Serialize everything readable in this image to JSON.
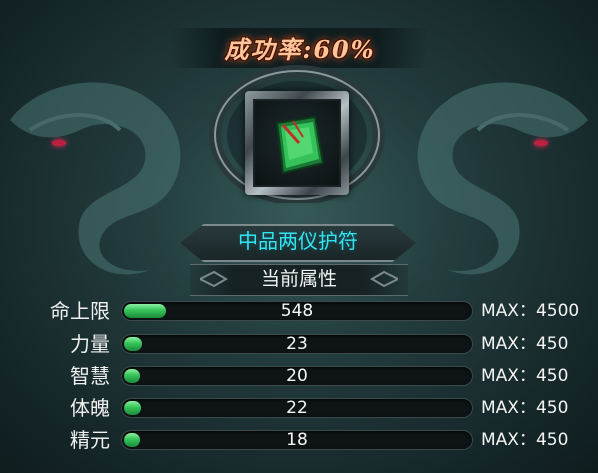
{
  "header": {
    "success_rate": "成功率:60%"
  },
  "item": {
    "name": "中品两仪护符",
    "icon": "jade-amulet-icon"
  },
  "attributes": {
    "title": "当前属性",
    "rows": [
      {
        "label": "命上限",
        "value": "548",
        "max": "MAX：4500",
        "fill": 0.122
      },
      {
        "label": "力量",
        "value": "23",
        "max": "MAX：450",
        "fill": 0.051
      },
      {
        "label": "智慧",
        "value": "20",
        "max": "MAX：450",
        "fill": 0.044
      },
      {
        "label": "体魄",
        "value": "22",
        "max": "MAX：450",
        "fill": 0.049
      },
      {
        "label": "精元",
        "value": "18",
        "max": "MAX：450",
        "fill": 0.04
      }
    ]
  },
  "colors": {
    "success_text": "#ffc59a",
    "item_name": "#34e4f0",
    "bar_fill": "#35c45a"
  }
}
